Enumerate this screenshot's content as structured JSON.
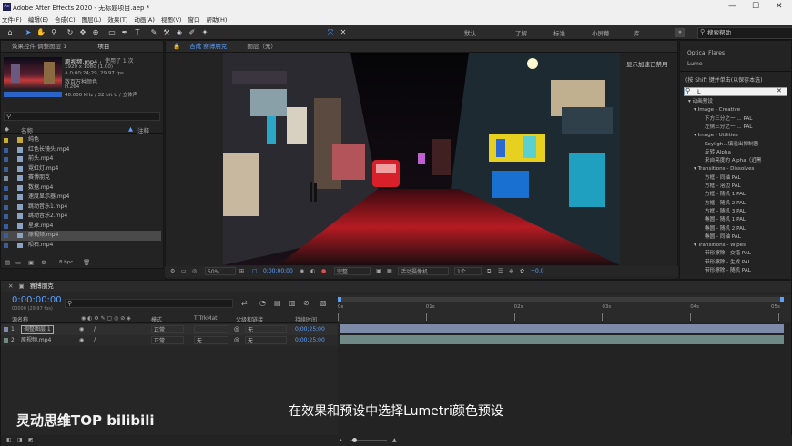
{
  "window": {
    "app_icon": "Ae",
    "title": "Adobe After Effects 2020 - 无标题项目.aep *",
    "minimize": "—",
    "maximize": "☐",
    "close": "✕"
  },
  "menu": [
    "文件(F)",
    "编辑(E)",
    "合成(C)",
    "图层(L)",
    "效果(T)",
    "动画(A)",
    "视图(V)",
    "窗口",
    "帮助(H)"
  ],
  "workspaces": [
    "默认",
    "了解",
    "标准",
    "小屏幕",
    "库"
  ],
  "search_help": {
    "placeholder": "搜索帮助"
  },
  "project_panel": {
    "tabs": [
      "效果控件 调整图层 1",
      "项目"
    ],
    "selected_file": {
      "name": "原视频.mp4",
      "used": "，使用了 1 次",
      "res": "1920 x 1080 (1.00)",
      "dur": "Δ 0;00;24;29, 29.97 fps",
      "colors": "数百万种颜色",
      "codec": "H.264",
      "audio": "48.000 kHz / 32 bit U / 立体声"
    },
    "columns": {
      "name": "名称",
      "note": "注释"
    },
    "files": [
      {
        "name": "纯色",
        "swatch": "#c7b030",
        "folder": true
      },
      {
        "name": "红色长镜头.mp4",
        "swatch": "#3a5d9c"
      },
      {
        "name": "前头.mp4",
        "swatch": "#3a5d9c"
      },
      {
        "name": "霓虹灯.mp4",
        "swatch": "#3a5d9c"
      },
      {
        "name": "赛博朋克",
        "swatch": "#7b8f9e"
      },
      {
        "name": "数据.mp4",
        "swatch": "#3a5d9c"
      },
      {
        "name": "速度显示器.mp4",
        "swatch": "#3a5d9c"
      },
      {
        "name": "跳动音乐1.mp4",
        "swatch": "#3a5d9c"
      },
      {
        "name": "跳动音乐2.mp4",
        "swatch": "#3a5d9c"
      },
      {
        "name": "星球.mp4",
        "swatch": "#3a5d9c"
      },
      {
        "name": "原视频.mp4",
        "swatch": "#3a5d9c",
        "selected": true
      },
      {
        "name": "陨石.mp4",
        "swatch": "#3a5d9c"
      }
    ],
    "bpc": "8 bpc"
  },
  "comp_panel": {
    "tab": "合成 赛博朋克",
    "layer_tab": "图层（无）",
    "zoom": "50%",
    "timecode": "0;00;00;00",
    "quality": "完整",
    "camera": "活动摄像机",
    "views": "1个...",
    "exposure": "+0.0"
  },
  "gpu_notice": "显示加速已禁用",
  "effects_panel": {
    "top_items": [
      "Optical Flares",
      "Lume"
    ],
    "hint": "(按 Shift 键并单击(以保存本选)",
    "search_value": "L",
    "tree": [
      {
        "t": "▾ 动画预设",
        "indent": 0
      },
      {
        "t": "▾ Image - Creative",
        "indent": 1
      },
      {
        "t": "下方三分之一 ... PAL",
        "indent": 3
      },
      {
        "t": "左侧三分之一 ... PAL",
        "indent": 3
      },
      {
        "t": "▾ Image - Utilities",
        "indent": 1
      },
      {
        "t": "Keyligh...填溢出抑制器",
        "indent": 3
      },
      {
        "t": "反转 Alpha",
        "indent": 3
      },
      {
        "t": "来自亮度的 Alpha（近黑",
        "indent": 3
      },
      {
        "t": "▾ Transitions - Dissolves",
        "indent": 1
      },
      {
        "t": "方框 - 同轴 PAL",
        "indent": 3
      },
      {
        "t": "方框 - 溶边 PAL",
        "indent": 3
      },
      {
        "t": "方框 - 随机 1 PAL",
        "indent": 3
      },
      {
        "t": "方框 - 随机 2 PAL",
        "indent": 3
      },
      {
        "t": "方框 - 随机 3 PAL",
        "indent": 3
      },
      {
        "t": "椭圆 - 随机 1 PAL",
        "indent": 3
      },
      {
        "t": "椭圆 - 随机 2 PAL",
        "indent": 3
      },
      {
        "t": "椭圆 - 同轴 PAL",
        "indent": 3
      },
      {
        "t": "▾ Transitions - Wipes",
        "indent": 1
      },
      {
        "t": "带形擦除 - 交错 PAL",
        "indent": 3
      },
      {
        "t": "带形擦除 - 生成 PAL",
        "indent": 3
      },
      {
        "t": "带形擦除 - 随机 PAL",
        "indent": 3
      }
    ]
  },
  "timeline": {
    "comp_name": "赛博朋克",
    "timecode": "0:00:00:00",
    "timecode_sub": "00000 (29.97 fps)",
    "columns": {
      "source": "源名称",
      "mode": "模式",
      "trkmat": "T TrkMat",
      "parent": "父级和链接",
      "duration": "持续时间"
    },
    "layers": [
      {
        "num": "1",
        "name": "调整图层 1",
        "mode": "正常",
        "trk": "",
        "parent": "无",
        "dur": "0;00;25;00",
        "bar": "#7d8aa8"
      },
      {
        "num": "2",
        "name": "原视频.mp4",
        "mode": "正常",
        "trk": "无",
        "parent": "无",
        "dur": "0;00;25;00",
        "bar": "#6f8a86"
      }
    ],
    "ruler": [
      "0s",
      "01s",
      "02s",
      "03s",
      "04s",
      "05s"
    ],
    "playhead_fraction": 0.0
  },
  "subtitle": "在效果和预设中选择Lumetri颜色预设",
  "watermark": "灵动思维TOP bilibili"
}
